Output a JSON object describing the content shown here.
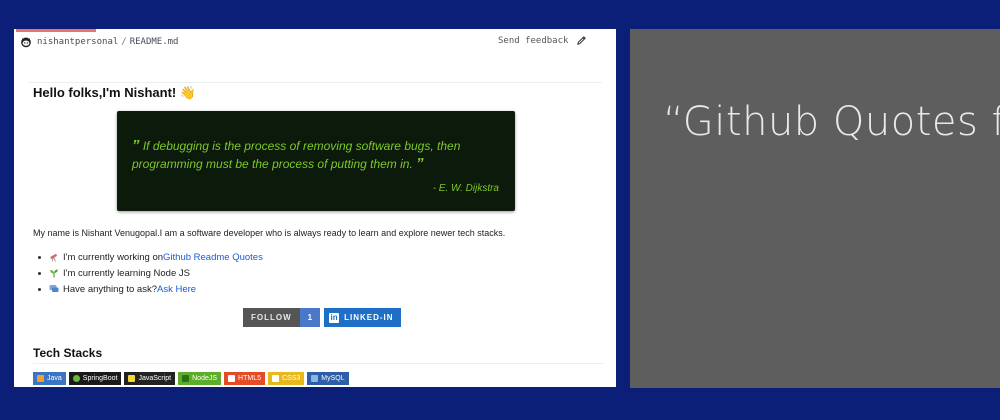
{
  "file_bar": {
    "repo": "nishantpersonal",
    "separator": "/",
    "file": "README.md",
    "feedback": "Send feedback"
  },
  "readme": {
    "greeting": "Hello folks,I'm Nishant! 👋",
    "quote": {
      "open_mark": "”",
      "text": "If debugging is the process of removing software bugs, then programming must be the process of putting them in.",
      "close_mark": "”",
      "author": "- E. W. Dijkstra"
    },
    "intro": "My name is Nishant Venugopal.I am a software developer who is always ready to learn and explore newer tech stacks.",
    "bullets": [
      {
        "icon": "telescope-icon",
        "text": "I'm currently working on ",
        "link": "Github Readme Quotes"
      },
      {
        "icon": "seedling-icon",
        "text": "I'm currently learning Node JS",
        "link": ""
      },
      {
        "icon": "speech-bubble-icon",
        "text": "Have anything to ask?",
        "link": "Ask Here"
      }
    ],
    "follow": {
      "label": "FOLLOW",
      "count": "1"
    },
    "linkedin": {
      "icon_letter": "in",
      "label": "LINKED-IN"
    },
    "tech_title": "Tech Stacks",
    "tech_badges": [
      {
        "label": "Java",
        "bg": "#3b74c3"
      },
      {
        "label": "SpringBoot",
        "bg": "#1a1a1a"
      },
      {
        "label": "JavaScript",
        "bg": "#222222"
      },
      {
        "label": "NodeJS",
        "bg": "#5cae2a"
      },
      {
        "label": "HTML5",
        "bg": "#e34c26"
      },
      {
        "label": "CSS3",
        "bg": "#e8b91a"
      },
      {
        "label": "MySQL",
        "bg": "#2f5ea8"
      }
    ]
  },
  "right_panel": {
    "title": "“Github Quotes fo"
  },
  "colors": {
    "background": "#0c1f78",
    "quote_text": "#7ec828",
    "link": "#1a5bd6",
    "panel": "#5e5e5e"
  }
}
